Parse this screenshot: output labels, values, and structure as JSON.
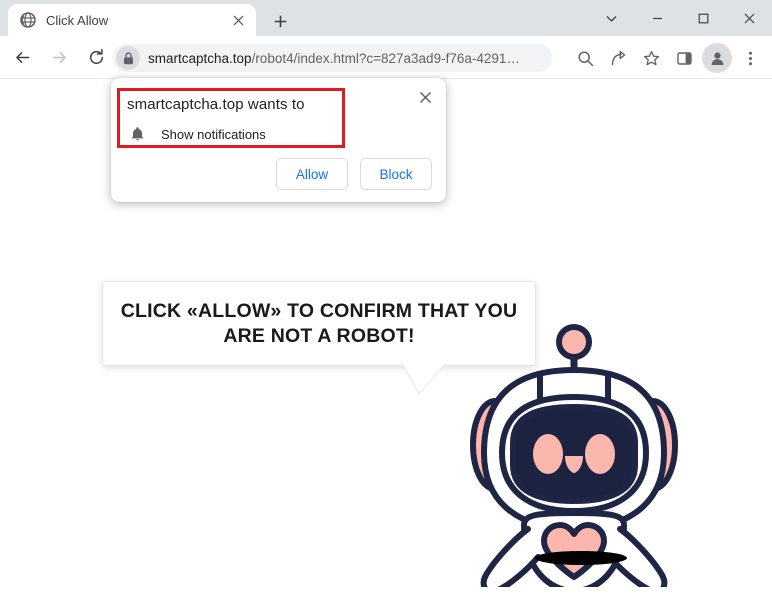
{
  "window": {
    "controls": [
      {
        "name": "tab-search",
        "icon": "chevron-down-icon"
      },
      {
        "name": "minimize",
        "icon": "minimize-icon"
      },
      {
        "name": "maximize",
        "icon": "maximize-icon"
      },
      {
        "name": "close",
        "icon": "close-icon"
      }
    ]
  },
  "tabs": [
    {
      "title": "Click Allow",
      "favicon": "globe-icon",
      "active": true
    }
  ],
  "newtab_tooltip": "New tab",
  "toolbar": {
    "back": "back-arrow-icon",
    "forward": "forward-arrow-icon",
    "reload": "reload-icon",
    "url_prefix": "smartcaptcha.top",
    "url_rest": "/robot4/index.html?c=827a3ad9-f76a-4291…",
    "url_full": "smartcaptcha.top/robot4/index.html?c=827a3ad9-f76a-4291…",
    "lock": "lock-icon",
    "icons": [
      {
        "name": "search-icon"
      },
      {
        "name": "share-icon"
      },
      {
        "name": "bookmark-star-icon"
      },
      {
        "name": "side-panel-icon"
      },
      {
        "name": "profile-avatar-icon"
      },
      {
        "name": "three-dot-menu-icon"
      }
    ]
  },
  "permission_dialog": {
    "title": "smartcaptcha.top wants to",
    "permission_label": "Show notifications",
    "permission_icon": "bell-icon",
    "allow_label": "Allow",
    "block_label": "Block",
    "close_icon": "close-icon",
    "highlight_color": "#e01b24"
  },
  "speech_bubble": {
    "line1": "CLICK «ALLOW» TO CONFIRM THAT YOU",
    "line2": "ARE NOT A ROBOT!"
  },
  "illustration": {
    "name": "robot-mascot",
    "outline_color": "#1f2544",
    "accent_color": "#fbb6ae",
    "face_color": "#1c2341",
    "shadow_color": "#000000"
  },
  "colors": {
    "tabstrip": "#dee1e6",
    "omnibox": "#f1f3f4",
    "link_blue": "#1a73e8",
    "page_background": "#ffffff"
  }
}
